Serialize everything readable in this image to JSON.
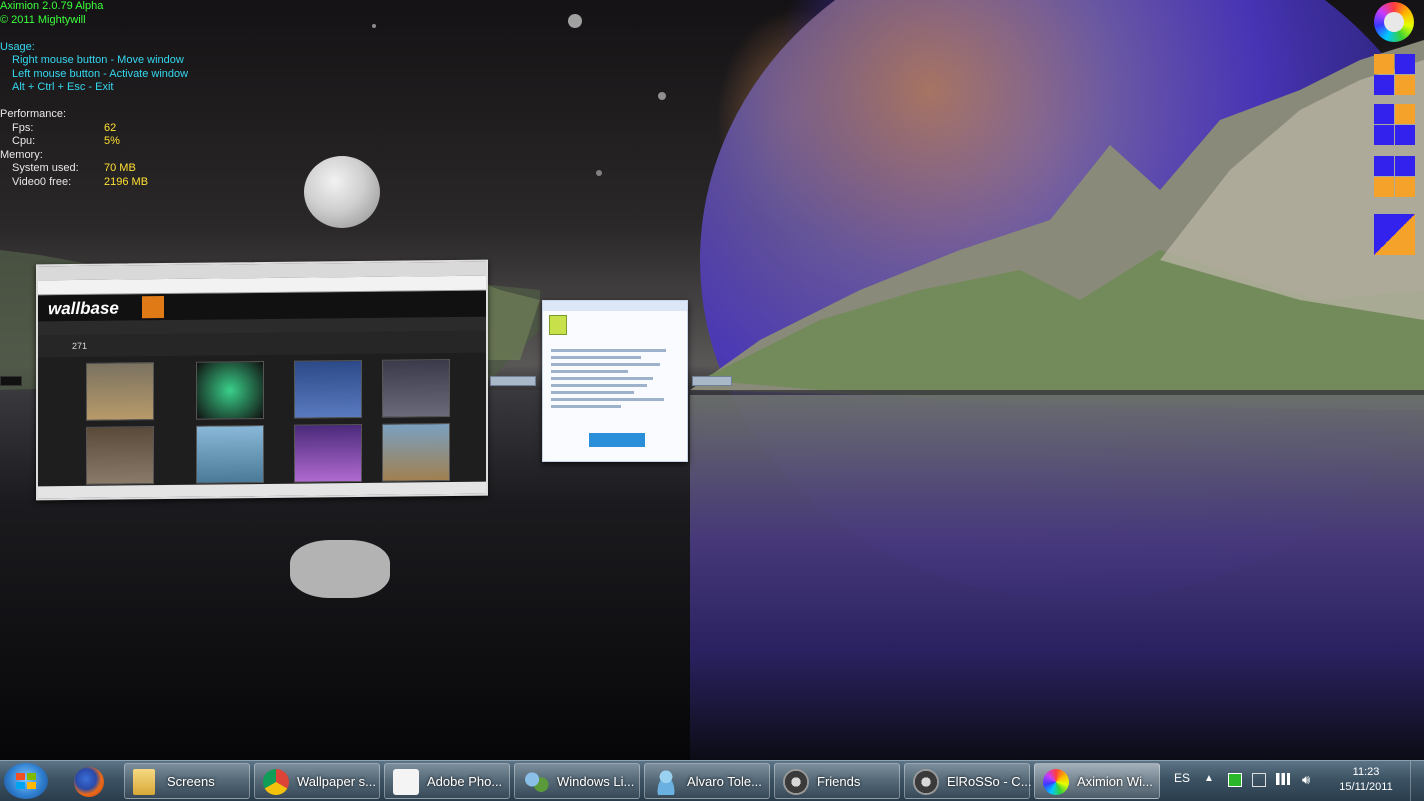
{
  "hud": {
    "title": "Aximion 2.0.79 Alpha",
    "copyright": "© 2011 Mightywill",
    "usage_label": "Usage:",
    "usage": [
      "Right mouse button  - Move window",
      "Left mouse button  - Activate window",
      "Alt + Ctrl + Esc  - Exit"
    ],
    "performance_label": "Performance:",
    "fps_label": "Fps:",
    "fps_value": "62",
    "cpu_label": "Cpu:",
    "cpu_value": "5%",
    "memory_label": "Memory:",
    "system_used_label": "System used:",
    "system_used_value": "70 MB",
    "video_free_label": "Video0 free:",
    "video_free_value": "2196 MB"
  },
  "browser_window": {
    "site_logo": "wallbase",
    "result_count": "271"
  },
  "taskbar": {
    "items": [
      {
        "label": "Screens",
        "icon": "folder-icon"
      },
      {
        "label": "Wallpaper s...",
        "icon": "chrome-icon"
      },
      {
        "label": "Adobe Pho...",
        "icon": "feather-icon"
      },
      {
        "label": "Windows Li...",
        "icon": "windows-live-icon"
      },
      {
        "label": "Alvaro Tole...",
        "icon": "messenger-icon"
      },
      {
        "label": "Friends",
        "icon": "steam-icon"
      },
      {
        "label": "ElRoSSo - C...",
        "icon": "steam-icon"
      },
      {
        "label": "Aximion Wi...",
        "icon": "aximion-icon"
      }
    ],
    "pinned": [
      "firefox-icon"
    ],
    "language": "ES",
    "clock_time": "11:23",
    "clock_date": "15/11/2011"
  },
  "colors": {
    "hud_green": "#3cff3c",
    "hud_cyan": "#35d8f0",
    "hud_yellow": "#ffe032",
    "switcher_blue": "#3322ee",
    "switcher_orange": "#f4a22a"
  }
}
